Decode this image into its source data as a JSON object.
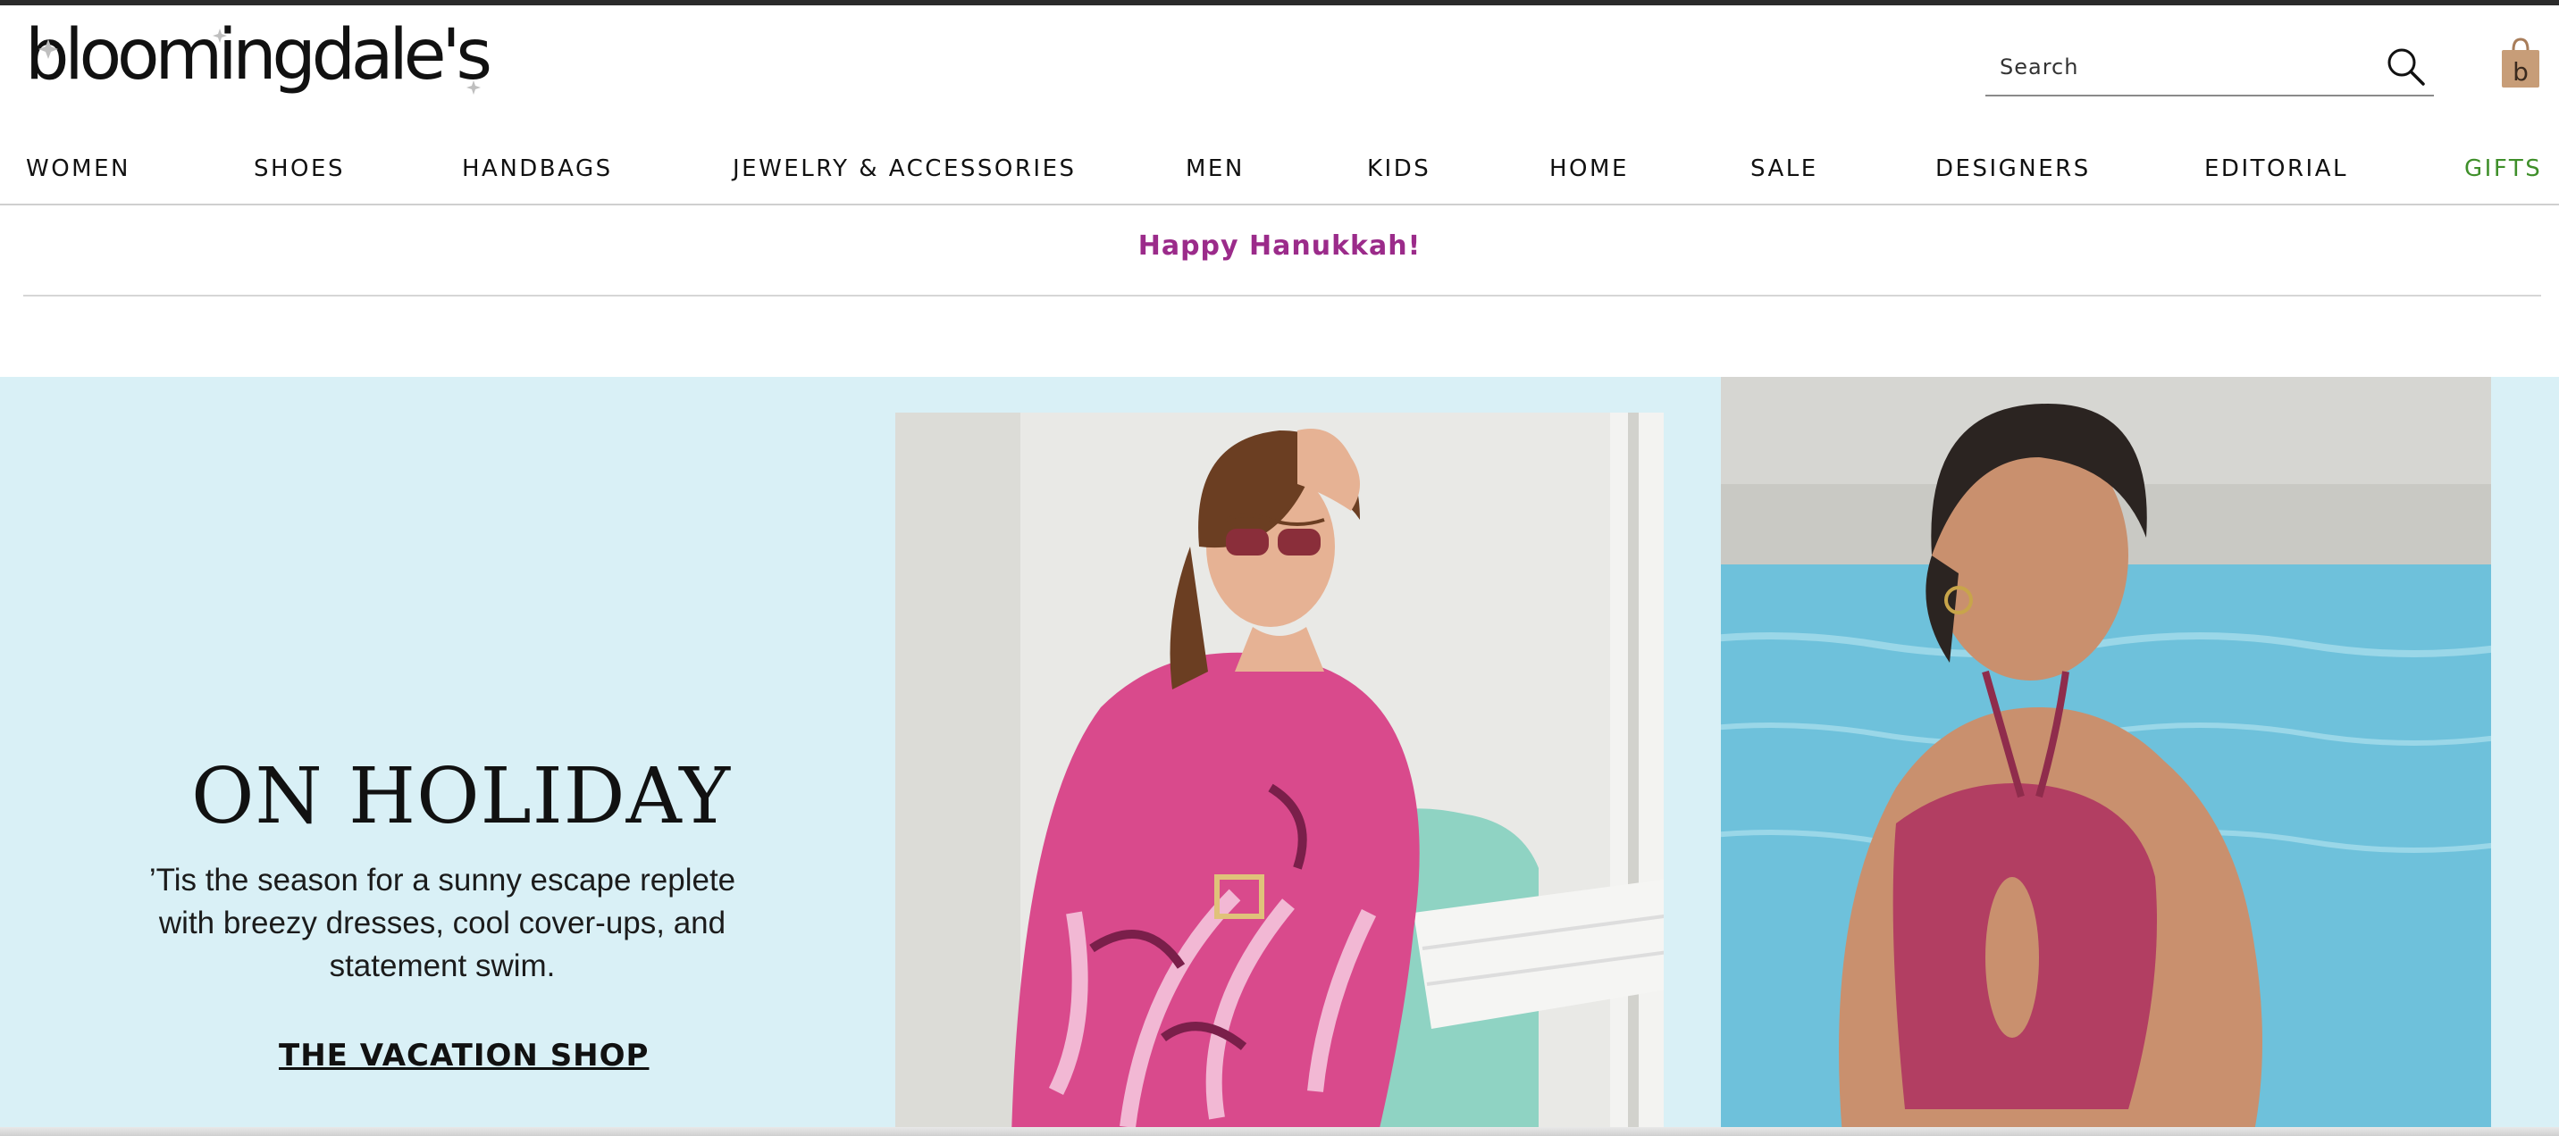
{
  "brand": {
    "logo_text": "bloomingdale's"
  },
  "search": {
    "placeholder": "Search",
    "value": ""
  },
  "nav": {
    "items": [
      {
        "label": "WOMEN"
      },
      {
        "label": "SHOES"
      },
      {
        "label": "HANDBAGS"
      },
      {
        "label": "JEWELRY & ACCESSORIES"
      },
      {
        "label": "MEN"
      },
      {
        "label": "KIDS"
      },
      {
        "label": "HOME"
      },
      {
        "label": "SALE"
      },
      {
        "label": "DESIGNERS"
      },
      {
        "label": "EDITORIAL"
      },
      {
        "label": "GIFTS"
      }
    ]
  },
  "promo": {
    "text": "Happy Hanukkah!"
  },
  "hero": {
    "title": "ON HOLIDAY",
    "body_lines": [
      "’Tis the season for a sunny escape replete",
      "with breezy dresses, cool cover-ups, and",
      "statement swim."
    ],
    "cta": "THE VACATION SHOP"
  },
  "icons": {
    "search": "search-icon",
    "bag": "shopping-bag-icon"
  },
  "colors": {
    "promo": "#9b2b8a",
    "gifts": "#3f8f2a",
    "hero_bg": "#d9f0f6",
    "top_bar": "#2b2b2b"
  }
}
